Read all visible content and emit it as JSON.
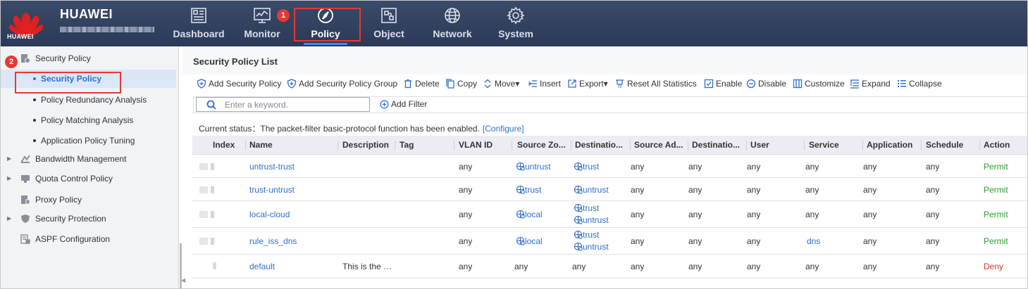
{
  "header": {
    "logo_text": "HUAWEI",
    "brand": "HUAWEI",
    "nav": [
      {
        "label": "Dashboard",
        "icon": "dashboard-icon"
      },
      {
        "label": "Monitor",
        "icon": "monitor-icon"
      },
      {
        "label": "Policy",
        "icon": "compass-icon",
        "active": true
      },
      {
        "label": "Object",
        "icon": "object-icon"
      },
      {
        "label": "Network",
        "icon": "globe-icon"
      },
      {
        "label": "System",
        "icon": "gear-icon"
      }
    ],
    "step_markers": [
      "1",
      "2"
    ]
  },
  "sidebar": {
    "items": [
      {
        "label": "Security Policy",
        "icon": "security-policy-icon",
        "expanded": true
      },
      {
        "label": "Security Policy",
        "sub": true,
        "active": true
      },
      {
        "label": "Policy Redundancy Analysis",
        "sub": true
      },
      {
        "label": "Policy Matching Analysis",
        "sub": true
      },
      {
        "label": "Application Policy Tuning",
        "sub": true
      },
      {
        "label": "Bandwidth Management",
        "icon": "bandwidth-icon",
        "expandable": true
      },
      {
        "label": "Quota Control Policy",
        "icon": "quota-icon",
        "expandable": true
      },
      {
        "label": "Proxy Policy",
        "icon": "proxy-icon"
      },
      {
        "label": "Security Protection",
        "icon": "shield-icon",
        "expandable": true
      },
      {
        "label": "ASPF Configuration",
        "icon": "aspf-icon"
      }
    ]
  },
  "main": {
    "title": "Security Policy List",
    "toolbar": [
      {
        "label": "Add Security Policy",
        "icon": "add-shield-icon"
      },
      {
        "label": "Add Security Policy Group",
        "icon": "add-group-icon"
      },
      {
        "label": "Delete",
        "icon": "trash-icon"
      },
      {
        "label": "Copy",
        "icon": "copy-icon"
      },
      {
        "label": "Move▾",
        "icon": "move-icon"
      },
      {
        "label": "Insert",
        "icon": "insert-icon"
      },
      {
        "label": "Export▾",
        "icon": "export-icon"
      },
      {
        "label": "Reset All Statistics",
        "icon": "reset-icon"
      },
      {
        "label": "Enable",
        "icon": "enable-icon"
      },
      {
        "label": "Disable",
        "icon": "disable-icon"
      },
      {
        "label": "Customize",
        "icon": "customize-icon"
      },
      {
        "label": "Expand",
        "icon": "expand-icon"
      },
      {
        "label": "Collapse",
        "icon": "collapse-icon"
      }
    ],
    "search_placeholder": "Enter a keyword.",
    "add_filter": "Add Filter",
    "status_text": "Current status：The packet-filter basic-protocol function has been enabled.",
    "status_link": "[Configure]"
  },
  "table": {
    "columns": [
      "Index",
      "Name",
      "Description",
      "Tag",
      "VLAN ID",
      "Source Zo...",
      "Destinatio...",
      "Source Ad...",
      "Destinatio...",
      "User",
      "Service",
      "Application",
      "Schedule",
      "Action"
    ],
    "rows": [
      {
        "name": "untrust-trust",
        "description": "",
        "tag": "",
        "vlan": "any",
        "src_zone": [
          "untrust"
        ],
        "dst_zone": [
          "trust"
        ],
        "src_addr": "any",
        "dst_addr": "any",
        "user": "any",
        "service": "any",
        "service_link": false,
        "application": "any",
        "schedule": "any",
        "action": "Permit"
      },
      {
        "name": "trust-untrust",
        "description": "",
        "tag": "",
        "vlan": "any",
        "src_zone": [
          "trust"
        ],
        "dst_zone": [
          "untrust"
        ],
        "src_addr": "any",
        "dst_addr": "any",
        "user": "any",
        "service": "any",
        "service_link": false,
        "application": "any",
        "schedule": "any",
        "action": "Permit"
      },
      {
        "name": "local-cloud",
        "description": "",
        "tag": "",
        "vlan": "any",
        "src_zone": [
          "local"
        ],
        "dst_zone": [
          "trust",
          "untrust"
        ],
        "src_addr": "any",
        "dst_addr": "any",
        "user": "any",
        "service": "any",
        "service_link": false,
        "application": "any",
        "schedule": "any",
        "action": "Permit"
      },
      {
        "name": "rule_iss_dns",
        "description": "",
        "tag": "",
        "vlan": "any",
        "src_zone": [
          "local"
        ],
        "dst_zone": [
          "trust",
          "untrust"
        ],
        "src_addr": "any",
        "dst_addr": "any",
        "user": "any",
        "service": "dns",
        "service_link": true,
        "application": "any",
        "schedule": "any",
        "action": "Permit"
      },
      {
        "name": "default",
        "description": "This is the …",
        "tag": "",
        "vlan": "any",
        "src_zone_text": "any",
        "dst_zone_text": "any",
        "src_addr": "any",
        "dst_addr": "any",
        "user": "any",
        "service": "any",
        "service_link": false,
        "application": "any",
        "schedule": "any",
        "action": "Deny"
      }
    ]
  },
  "colors": {
    "header_bg": "#2c3a57",
    "accent": "#2f6ecb",
    "permit": "#2e9b2e",
    "deny": "#d9342b",
    "marker": "#e53935"
  }
}
